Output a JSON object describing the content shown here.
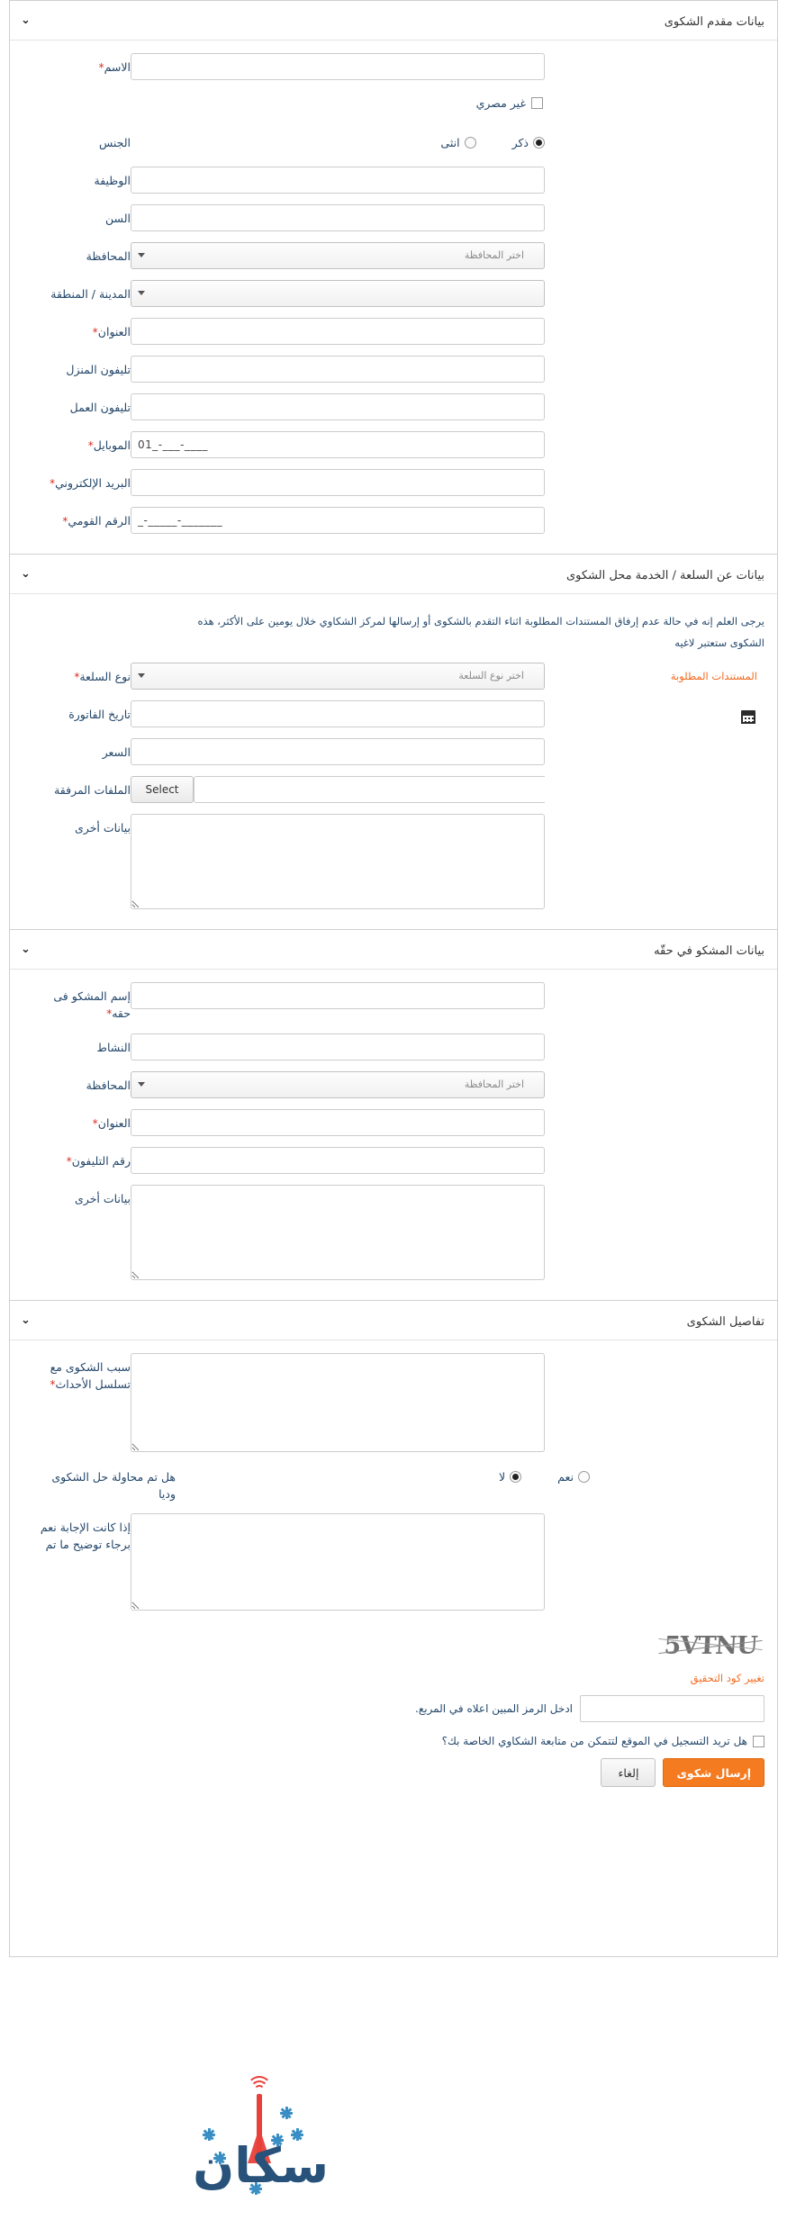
{
  "sections": {
    "complainant": {
      "title": "بيانات مقدم الشكوى",
      "fields": {
        "name": "الاسم",
        "non_egyptian": "غير مصري",
        "gender": "الجنس",
        "gender_male": "ذكر",
        "gender_female": "انثى",
        "job": "الوظيفة",
        "age": "السن",
        "governorate": "المحافظة",
        "city": "المدينة / المنطقة",
        "address": "العنوان",
        "home_phone": "تليفون المنزل",
        "work_phone": "تليفون العمل",
        "mobile": "الموبايل",
        "email": "البريد الإلكتروني",
        "national_id": "الرقم القومي"
      },
      "values": {
        "mobile_mask": "01_-___-____",
        "national_id_mask": "_-_____-_______"
      },
      "placeholders": {
        "governorate": "اختر المحافظة",
        "city": ""
      }
    },
    "product": {
      "title": "بيانات عن السلعة / الخدمة محل الشكوى",
      "note_line1": "يرجى العلم إنه في حالة عدم إرفاق المستندات المطلوبة اثناء التقدم بالشكوى أو إرسالها لمركز الشكاوي خلال يومين على الأكثر، هذه",
      "note_line2": "الشكوى ستعتبر لاغيه",
      "required_docs_link": "المستندات المطلوبة",
      "fields": {
        "product_type": "نوع السلعة",
        "invoice_date": "تاريخ الفاتورة",
        "price": "السعر",
        "attachments": "الملفات المرفقة",
        "other_data": "بيانات أخرى"
      },
      "placeholders": {
        "product_type": "اختر نوع السلعة"
      },
      "select_button": "Select"
    },
    "defendant": {
      "title": "بيانات المشكو في حقّه",
      "fields": {
        "name": "إسم المشكو فى حقه",
        "activity": "النشاط",
        "governorate": "المحافظة",
        "address": "العنوان",
        "phone": "رقم التليفون",
        "other_data": "بيانات أخرى"
      },
      "placeholders": {
        "governorate": "اختر المحافظة"
      }
    },
    "details": {
      "title": "تفاصيل الشكوى",
      "fields": {
        "reason": "سبب الشكوى مع تسلسل الأحداث",
        "amicable_question": "هل تم محاولة حل الشكوى وديا",
        "yes": "نعم",
        "no": "لا",
        "if_yes": "إذا كانت الإجابة نعم برجاء توضيح ما تم"
      }
    }
  },
  "captcha": {
    "code": "5VTNU",
    "refresh_label": "تغيير كود التحقيق",
    "input_label": "ادخل الرمز المبين اعلاه في المربع.",
    "input_value": ""
  },
  "footer": {
    "register_question": "هل تريد التسجيل في الموقع لتتمكن من متابعة الشكاوي الخاصة بك؟",
    "submit_label": "إرسال شكوى",
    "cancel_label": "إلغاء",
    "logo_text": "سكان"
  },
  "icons": {
    "chevron": "⌄",
    "required_star": "*"
  },
  "colors": {
    "accent_orange": "#f47b20",
    "label_blue": "#24476b",
    "required_red": "#d62d20",
    "logo_blue": "#28527a",
    "logo_red": "#e8413a"
  }
}
